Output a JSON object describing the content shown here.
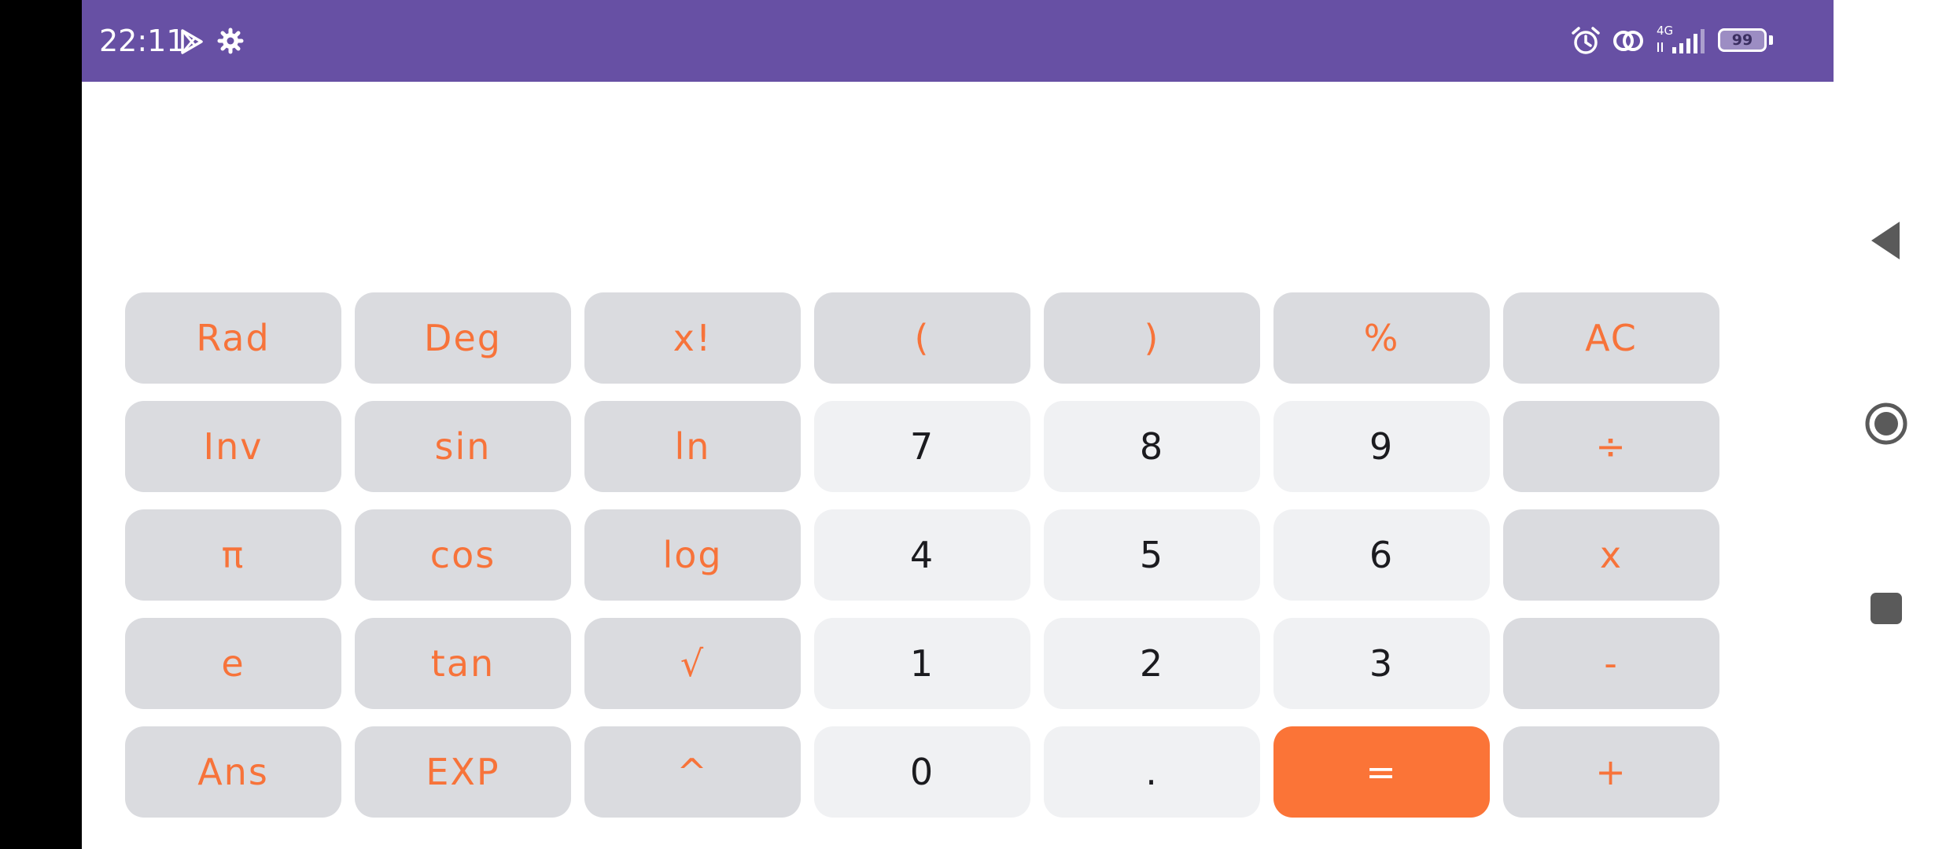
{
  "status_bar": {
    "time": "22:11",
    "icons": [
      "play-store-icon",
      "settings-gear-icon",
      "alarm-icon",
      "hotspot-link-icon",
      "4g-signal-icon",
      "battery-icon"
    ],
    "network": "4G",
    "battery_level": "99"
  },
  "display": {
    "expression": "",
    "result": ""
  },
  "keypad": {
    "rows": [
      [
        {
          "label": "Rad",
          "kind": "func",
          "name": "rad-key"
        },
        {
          "label": "Deg",
          "kind": "func",
          "name": "deg-key"
        },
        {
          "label": "x!",
          "kind": "func",
          "name": "factorial-key"
        },
        {
          "label": "(",
          "kind": "func",
          "name": "open-paren-key"
        },
        {
          "label": ")",
          "kind": "func",
          "name": "close-paren-key"
        },
        {
          "label": "%",
          "kind": "func",
          "name": "percent-key"
        },
        {
          "label": "AC",
          "kind": "func",
          "name": "all-clear-key"
        }
      ],
      [
        {
          "label": "Inv",
          "kind": "func",
          "name": "inverse-key"
        },
        {
          "label": "sin",
          "kind": "func",
          "name": "sin-key"
        },
        {
          "label": "ln",
          "kind": "func",
          "name": "ln-key"
        },
        {
          "label": "7",
          "kind": "num",
          "name": "digit-7-key"
        },
        {
          "label": "8",
          "kind": "num",
          "name": "digit-8-key"
        },
        {
          "label": "9",
          "kind": "num",
          "name": "digit-9-key"
        },
        {
          "label": "÷",
          "kind": "func",
          "name": "divide-key"
        }
      ],
      [
        {
          "label": "π",
          "kind": "func",
          "name": "pi-key"
        },
        {
          "label": "cos",
          "kind": "func",
          "name": "cos-key"
        },
        {
          "label": "log",
          "kind": "func",
          "name": "log-key"
        },
        {
          "label": "4",
          "kind": "num",
          "name": "digit-4-key"
        },
        {
          "label": "5",
          "kind": "num",
          "name": "digit-5-key"
        },
        {
          "label": "6",
          "kind": "num",
          "name": "digit-6-key"
        },
        {
          "label": "x",
          "kind": "func",
          "name": "multiply-key"
        }
      ],
      [
        {
          "label": "e",
          "kind": "func",
          "name": "euler-key"
        },
        {
          "label": "tan",
          "kind": "func",
          "name": "tan-key"
        },
        {
          "label": "√",
          "kind": "func",
          "name": "sqrt-key"
        },
        {
          "label": "1",
          "kind": "num",
          "name": "digit-1-key"
        },
        {
          "label": "2",
          "kind": "num",
          "name": "digit-2-key"
        },
        {
          "label": "3",
          "kind": "num",
          "name": "digit-3-key"
        },
        {
          "label": "-",
          "kind": "func",
          "name": "subtract-key"
        }
      ],
      [
        {
          "label": "Ans",
          "kind": "func",
          "name": "ans-key"
        },
        {
          "label": "EXP",
          "kind": "func",
          "name": "exp-key"
        },
        {
          "label": "^",
          "kind": "func",
          "name": "power-key"
        },
        {
          "label": "0",
          "kind": "num",
          "name": "digit-0-key"
        },
        {
          "label": ".",
          "kind": "num",
          "name": "decimal-point-key"
        },
        {
          "label": "=",
          "kind": "eq",
          "name": "equals-key"
        },
        {
          "label": "+",
          "kind": "func",
          "name": "add-key"
        }
      ]
    ]
  },
  "nav_bar": {
    "icons": [
      "back-triangle-icon",
      "home-circle-icon",
      "recents-square-icon"
    ]
  },
  "colors": {
    "status_bar": "#6750a4",
    "func_key_bg": "#dadbdf",
    "func_key_text": "#f7733a",
    "num_key_bg": "#f0f1f3",
    "num_key_text": "#1b1b1f",
    "equals_bg": "#fb7437",
    "equals_text": "#ffffff"
  }
}
